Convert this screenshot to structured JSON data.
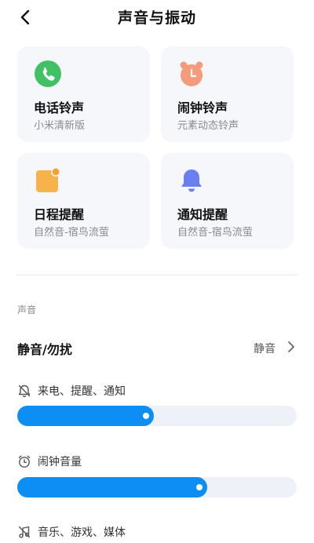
{
  "header": {
    "title": "声音与振动"
  },
  "cards": [
    {
      "title": "电话铃声",
      "subtitle": "小米清新版",
      "icon": "phone-icon",
      "color": "#42c065"
    },
    {
      "title": "闹钟铃声",
      "subtitle": "元素动态铃声",
      "icon": "alarm-clock-icon",
      "color": "#f59b7c"
    },
    {
      "title": "日程提醒",
      "subtitle": "自然音-宿鸟流萤",
      "icon": "calendar-icon",
      "color": "#f7b24c"
    },
    {
      "title": "通知提醒",
      "subtitle": "自然音-宿鸟流萤",
      "icon": "bell-icon",
      "color": "#6b7ff0"
    }
  ],
  "section": {
    "label": "声音"
  },
  "mute_row": {
    "label": "静音/勿扰",
    "value": "静音"
  },
  "volumes": [
    {
      "label": "来电、提醒、通知",
      "icon": "bell-outline-icon",
      "level": 0.49
    },
    {
      "label": "闹钟音量",
      "icon": "alarm-outline-icon",
      "level": 0.68
    },
    {
      "label": "音乐、游戏、媒体",
      "icon": "music-note-icon",
      "level": null
    }
  ],
  "colors": {
    "accent": "#0d8ef5",
    "card_bg": "#f5f7fb",
    "track_bg": "#eef2f8"
  }
}
